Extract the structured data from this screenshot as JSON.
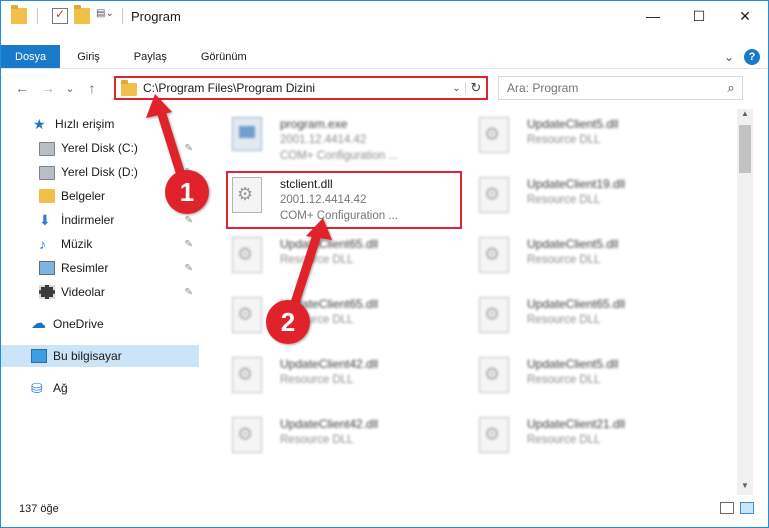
{
  "window": {
    "title": "Program",
    "minimize": "—",
    "maximize": "☐",
    "close": "✕"
  },
  "ribbon": {
    "tabs": [
      "Dosya",
      "Giriş",
      "Paylaş",
      "Görünüm"
    ],
    "expand": "⌄",
    "help": "?"
  },
  "nav": {
    "back": "←",
    "forward": "→",
    "recent": "⌄",
    "up": "↑"
  },
  "address": {
    "path": "C:\\Program Files\\Program Dizini",
    "dropdown": "⌄",
    "refresh": "↻"
  },
  "search": {
    "placeholder": "Ara: Program",
    "icon": "⌕"
  },
  "sidebar": {
    "items": [
      {
        "label": "Hızlı erişim",
        "icon": "star-icon",
        "pinned": false
      },
      {
        "label": "Yerel Disk (C:)",
        "icon": "drive-icon",
        "pinned": true
      },
      {
        "label": "Yerel Disk (D:)",
        "icon": "drive-icon",
        "pinned": true
      },
      {
        "label": "Belgeler",
        "icon": "documents-icon",
        "pinned": true
      },
      {
        "label": "İndirmeler",
        "icon": "download-icon",
        "pinned": true
      },
      {
        "label": "Müzik",
        "icon": "music-icon",
        "pinned": true
      },
      {
        "label": "Resimler",
        "icon": "pictures-icon",
        "pinned": true
      },
      {
        "label": "Videolar",
        "icon": "videos-icon",
        "pinned": true
      },
      {
        "label": "OneDrive",
        "icon": "cloud-icon",
        "pinned": false
      },
      {
        "label": "Bu bilgisayar",
        "icon": "computer-icon",
        "pinned": false,
        "selected": true
      },
      {
        "label": "Ağ",
        "icon": "network-icon",
        "pinned": false
      }
    ],
    "pin_glyph": "📌"
  },
  "files": {
    "left": [
      {
        "name": "program.exe",
        "line1": "2001.12.4414.42",
        "line2": "COM+ Configuration ...",
        "icon": "exe-icon"
      },
      {
        "name": "stclient.dll",
        "line1": "2001.12.4414.42",
        "line2": "COM+ Configuration ...",
        "icon": "dll-icon"
      },
      {
        "name": "UpdateClient65.dll",
        "line1": "Resource DLL",
        "line2": "",
        "icon": "dll-icon"
      },
      {
        "name": "UpdateClient65.dll",
        "line1": "Resource DLL",
        "line2": "",
        "icon": "dll-icon"
      },
      {
        "name": "UpdateClient42.dll",
        "line1": "Resource DLL",
        "line2": "",
        "icon": "dll-icon"
      },
      {
        "name": "UpdateClient42.dll",
        "line1": "Resource DLL",
        "line2": "",
        "icon": "dll-icon"
      }
    ],
    "right": [
      {
        "name": "UpdateClient5.dll",
        "line1": "Resource DLL",
        "icon": "dll-icon"
      },
      {
        "name": "UpdateClient19.dll",
        "line1": "Resource DLL",
        "icon": "dll-icon"
      },
      {
        "name": "UpdateClient5.dll",
        "line1": "Resource DLL",
        "icon": "dll-icon"
      },
      {
        "name": "UpdateClient65.dll",
        "line1": "Resource DLL",
        "icon": "dll-icon"
      },
      {
        "name": "UpdateClient5.dll",
        "line1": "Resource DLL",
        "icon": "dll-icon"
      },
      {
        "name": "UpdateClient21.dll",
        "line1": "Resource DLL",
        "icon": "dll-icon"
      }
    ]
  },
  "status": {
    "count": "137 öğe"
  },
  "annotations": {
    "badge1": "1",
    "badge2": "2",
    "color": "#e0242c"
  }
}
